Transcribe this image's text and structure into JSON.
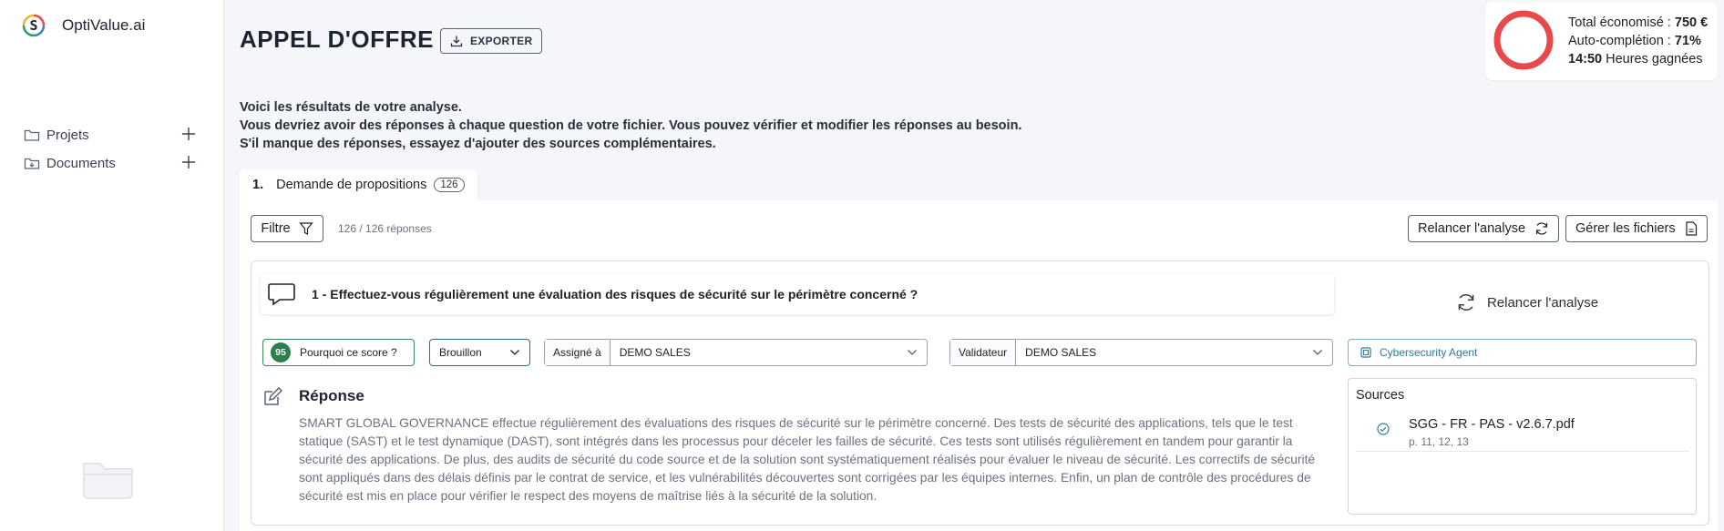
{
  "brand": {
    "logo_letter": "S",
    "name": "OptiValue.ai"
  },
  "sidebar": {
    "items": [
      {
        "label": "Projets"
      },
      {
        "label": "Documents"
      }
    ]
  },
  "header": {
    "title": "APPEL D'OFFRE",
    "export_label": "EXPORTER"
  },
  "stats": {
    "saved_label": "Total économisé : ",
    "saved_value": "750 €",
    "completion_label": "Auto-complétion : ",
    "completion_value": "71%",
    "hours_value": "14:50",
    "hours_label": " Heures gagnées",
    "ring_color": "#e8494b"
  },
  "intro": {
    "line1": "Voici les résultats de votre analyse.",
    "line2": "Vous devriez avoir des réponses à chaque question de votre fichier. Vous pouvez vérifier et modifier les réponses au besoin.",
    "line3": "S'il manque des réponses, essayez d'ajouter des sources complémentaires."
  },
  "tab": {
    "number": "1.",
    "label": "Demande de propositions",
    "count": "126"
  },
  "toolbar": {
    "filter_label": "Filtre",
    "response_count": "126 / 126 réponses",
    "relaunch_label": "Relancer l'analyse",
    "manage_files_label": "Gérer les fichiers"
  },
  "question": {
    "text": "1 - Effectuez-vous régulièrement une évaluation des risques de sécurité sur le périmètre concerné ?",
    "relaunch_label": "Relancer l'analyse",
    "score": "95",
    "score_label": "Pourquoi ce score ?",
    "status": "Brouillon",
    "assigned_label": "Assigné à",
    "assigned_value": "DEMO SALES",
    "validator_label": "Validateur",
    "validator_value": "DEMO SALES",
    "agent_label": "Cybersecurity Agent"
  },
  "answer": {
    "title": "Réponse",
    "text": "SMART GLOBAL GOVERNANCE effectue régulièrement des évaluations des risques de sécurité sur le périmètre concerné. Des tests de sécurité des applications, tels que le test statique (SAST) et le test dynamique (DAST), sont intégrés dans les processus pour déceler les failles de sécurité. Ces tests sont utilisés régulièrement en tandem pour garantir la sécurité des applications. De plus, des audits de sécurité du code source et de la solution sont systématiquement réalisés pour évaluer le niveau de sécurité. Les correctifs de sécurité sont appliqués dans des délais définis par le contrat de service, et les vulnérabilités découvertes sont corrigées par les équipes internes. Enfin, un plan de contrôle des procédures de sécurité est mis en place pour vérifier le respect des moyens de maîtrise liés à la sécurité de la solution."
  },
  "sources": {
    "title": "Sources",
    "items": [
      {
        "filename": "SGG - FR - PAS - v2.6.7.pdf",
        "pages": "p. 11, 12, 13"
      }
    ]
  }
}
